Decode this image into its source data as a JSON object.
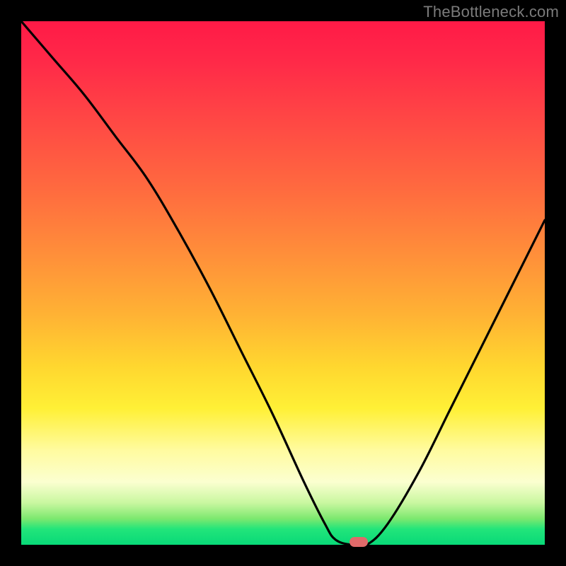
{
  "watermark": "TheBottleneck.com",
  "marker_color": "#e06a6a",
  "chart_data": {
    "type": "line",
    "title": "",
    "xlabel": "",
    "ylabel": "",
    "xlim": [
      0,
      100
    ],
    "ylim": [
      0,
      100
    ],
    "series": [
      {
        "name": "curve",
        "x": [
          0,
          6,
          12,
          18,
          24,
          30,
          36,
          42,
          48,
          54,
          58,
          60,
          63,
          66,
          70,
          76,
          82,
          88,
          94,
          100
        ],
        "y": [
          100,
          93,
          86,
          78,
          70,
          60,
          49,
          37,
          25,
          12,
          4,
          1,
          0,
          0,
          4,
          14,
          26,
          38,
          50,
          62
        ]
      }
    ],
    "marker": {
      "x": 64.5,
      "y": 0,
      "color": "#e06a6a"
    },
    "background_gradient": {
      "stops": [
        {
          "pos": 0,
          "color": "#ff1a47"
        },
        {
          "pos": 18,
          "color": "#ff4545"
        },
        {
          "pos": 44,
          "color": "#ff8d3a"
        },
        {
          "pos": 66,
          "color": "#ffd72f"
        },
        {
          "pos": 82,
          "color": "#fffba0"
        },
        {
          "pos": 95,
          "color": "#7de86f"
        },
        {
          "pos": 100,
          "color": "#08d978"
        }
      ]
    }
  }
}
